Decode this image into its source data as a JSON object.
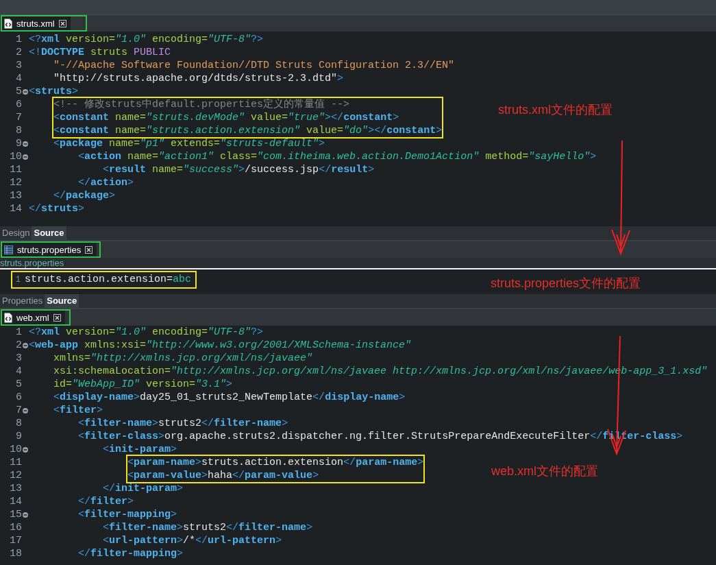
{
  "editors": [
    {
      "kind": "xml",
      "tabs": [
        {
          "label": "struts.xml",
          "selected": true
        }
      ],
      "lines": [
        {
          "num": "1",
          "boxed": false,
          "tokens": [
            {
              "kind": "punct",
              "text": "<?"
            },
            {
              "kind": "tag",
              "text": "xml"
            },
            {
              "kind": "attr",
              "text": " version="
            },
            {
              "kind": "value",
              "text": "\"1.0\""
            },
            {
              "kind": "attr",
              "text": " encoding="
            },
            {
              "kind": "value",
              "text": "\"UTF-8\""
            },
            {
              "kind": "punct",
              "text": "?>"
            }
          ]
        },
        {
          "num": "2",
          "boxed": false,
          "tokens": [
            {
              "kind": "punct",
              "text": "<!"
            },
            {
              "kind": "tag",
              "text": "DOCTYPE"
            },
            {
              "kind": "attr",
              "text": " struts "
            },
            {
              "kind": "keyword",
              "text": "PUBLIC"
            }
          ]
        },
        {
          "num": "3",
          "boxed": false,
          "tokens": [
            {
              "kind": "string",
              "text": "    \"-//Apache Software Foundation//DTD Struts Configuration 2.3//EN\""
            }
          ]
        },
        {
          "num": "4",
          "boxed": false,
          "tokens": [
            {
              "kind": "text",
              "text": "    \"http://struts.apache.org/dtds/struts-2.3.dtd\""
            },
            {
              "kind": "punct",
              "text": ">"
            }
          ]
        },
        {
          "num": "5",
          "foldable": true,
          "boxed": false,
          "tokens": [
            {
              "kind": "punct",
              "text": "<"
            },
            {
              "kind": "tag",
              "text": "struts"
            },
            {
              "kind": "punct",
              "text": ">"
            }
          ]
        },
        {
          "num": "6",
          "boxed": true,
          "tokens": [
            {
              "kind": "comment",
              "text": "    <!-- 修改struts中default.properties定义的常量值 -->"
            }
          ]
        },
        {
          "num": "7",
          "boxed": true,
          "tokens": [
            {
              "kind": "punct",
              "text": "    <"
            },
            {
              "kind": "tag",
              "text": "constant"
            },
            {
              "kind": "attr",
              "text": " name="
            },
            {
              "kind": "value",
              "text": "\"struts.devMode\""
            },
            {
              "kind": "attr",
              "text": " value="
            },
            {
              "kind": "value",
              "text": "\"true\""
            },
            {
              "kind": "punct",
              "text": "></"
            },
            {
              "kind": "tag",
              "text": "constant"
            },
            {
              "kind": "punct",
              "text": ">"
            }
          ]
        },
        {
          "num": "8",
          "boxed": true,
          "tokens": [
            {
              "kind": "punct",
              "text": "    <"
            },
            {
              "kind": "tag",
              "text": "constant"
            },
            {
              "kind": "attr",
              "text": " name="
            },
            {
              "kind": "value",
              "text": "\"struts.action.extension\""
            },
            {
              "kind": "attr",
              "text": " value="
            },
            {
              "kind": "value",
              "text": "\"do\""
            },
            {
              "kind": "punct",
              "text": "></"
            },
            {
              "kind": "tag",
              "text": "constant"
            },
            {
              "kind": "punct",
              "text": ">"
            }
          ]
        },
        {
          "num": "9",
          "foldable": true,
          "boxed": false,
          "tokens": [
            {
              "kind": "punct",
              "text": "    <"
            },
            {
              "kind": "tag",
              "text": "package"
            },
            {
              "kind": "attr",
              "text": " name="
            },
            {
              "kind": "value",
              "text": "\"p1\""
            },
            {
              "kind": "attr",
              "text": " extends="
            },
            {
              "kind": "value",
              "text": "\"struts-default\""
            },
            {
              "kind": "punct",
              "text": ">"
            }
          ]
        },
        {
          "num": "10",
          "foldable": true,
          "boxed": false,
          "tokens": [
            {
              "kind": "punct",
              "text": "        <"
            },
            {
              "kind": "tag",
              "text": "action"
            },
            {
              "kind": "attr",
              "text": " name="
            },
            {
              "kind": "value",
              "text": "\"action1\""
            },
            {
              "kind": "attr",
              "text": " class="
            },
            {
              "kind": "value",
              "text": "\"com.itheima.web.action.Demo1Action\""
            },
            {
              "kind": "attr",
              "text": " method="
            },
            {
              "kind": "value",
              "text": "\"sayHello\""
            },
            {
              "kind": "punct",
              "text": ">"
            }
          ]
        },
        {
          "num": "11",
          "boxed": false,
          "tokens": [
            {
              "kind": "punct",
              "text": "            <"
            },
            {
              "kind": "tag",
              "text": "result"
            },
            {
              "kind": "attr",
              "text": " name="
            },
            {
              "kind": "value",
              "text": "\"success\""
            },
            {
              "kind": "punct",
              "text": ">"
            },
            {
              "kind": "text",
              "text": "/success.jsp"
            },
            {
              "kind": "punct",
              "text": "</"
            },
            {
              "kind": "tag",
              "text": "result"
            },
            {
              "kind": "punct",
              "text": ">"
            }
          ]
        },
        {
          "num": "12",
          "boxed": false,
          "tokens": [
            {
              "kind": "punct",
              "text": "        </"
            },
            {
              "kind": "tag",
              "text": "action"
            },
            {
              "kind": "punct",
              "text": ">"
            }
          ]
        },
        {
          "num": "13",
          "boxed": false,
          "tokens": [
            {
              "kind": "punct",
              "text": "    </"
            },
            {
              "kind": "tag",
              "text": "package"
            },
            {
              "kind": "punct",
              "text": ">"
            }
          ]
        },
        {
          "num": "14",
          "boxed": false,
          "tokens": [
            {
              "kind": "punct",
              "text": "</"
            },
            {
              "kind": "tag",
              "text": "struts"
            },
            {
              "kind": "punct",
              "text": ">"
            }
          ]
        }
      ],
      "view_tabs": [
        {
          "label": "Design",
          "selected": false
        },
        {
          "label": "Source",
          "selected": true
        }
      ]
    },
    {
      "kind": "properties",
      "tabs": [
        {
          "label": "struts.properties",
          "selected": true
        }
      ],
      "breadcrumb": "struts.properties",
      "lines": [
        {
          "num": "1",
          "boxed": true,
          "tokens": [
            {
              "kind": "text",
              "text": "struts.action.extension="
            },
            {
              "kind": "value_plain",
              "text": "abc"
            }
          ]
        }
      ],
      "view_tabs": [
        {
          "label": "Properties",
          "selected": false
        },
        {
          "label": "Source",
          "selected": true
        }
      ]
    },
    {
      "kind": "xml",
      "tabs": [
        {
          "label": "web.xml",
          "selected": true
        }
      ],
      "lines": [
        {
          "num": "1",
          "boxed": false,
          "tokens": [
            {
              "kind": "punct",
              "text": "<?"
            },
            {
              "kind": "tag",
              "text": "xml"
            },
            {
              "kind": "attr",
              "text": " version="
            },
            {
              "kind": "value",
              "text": "\"1.0\""
            },
            {
              "kind": "attr",
              "text": " encoding="
            },
            {
              "kind": "value",
              "text": "\"UTF-8\""
            },
            {
              "kind": "punct",
              "text": "?>"
            }
          ]
        },
        {
          "num": "2",
          "foldable": true,
          "boxed": false,
          "tokens": [
            {
              "kind": "punct",
              "text": "<"
            },
            {
              "kind": "tag",
              "text": "web-app"
            },
            {
              "kind": "attr",
              "text": " xmlns:xsi="
            },
            {
              "kind": "value",
              "text": "\"http://www.w3.org/2001/XMLSchema-instance\""
            }
          ]
        },
        {
          "num": "3",
          "boxed": false,
          "tokens": [
            {
              "kind": "attr",
              "text": "    xmlns="
            },
            {
              "kind": "value",
              "text": "\"http://xmlns.jcp.org/xml/ns/javaee\""
            }
          ]
        },
        {
          "num": "4",
          "boxed": false,
          "tokens": [
            {
              "kind": "attr",
              "text": "    xsi:schemaLocation="
            },
            {
              "kind": "value",
              "text": "\"http://xmlns.jcp.org/xml/ns/javaee http://xmlns.jcp.org/xml/ns/javaee/web-app_3_1.xsd\""
            }
          ]
        },
        {
          "num": "5",
          "boxed": false,
          "tokens": [
            {
              "kind": "attr",
              "text": "    id="
            },
            {
              "kind": "value",
              "text": "\"WebApp_ID\""
            },
            {
              "kind": "attr",
              "text": " version="
            },
            {
              "kind": "value",
              "text": "\"3.1\""
            },
            {
              "kind": "punct",
              "text": ">"
            }
          ]
        },
        {
          "num": "6",
          "boxed": false,
          "tokens": [
            {
              "kind": "punct",
              "text": "    <"
            },
            {
              "kind": "tag",
              "text": "display-name"
            },
            {
              "kind": "punct",
              "text": ">"
            },
            {
              "kind": "text",
              "text": "day25_01_struts2_NewTemplate"
            },
            {
              "kind": "punct",
              "text": "</"
            },
            {
              "kind": "tag",
              "text": "display-name"
            },
            {
              "kind": "punct",
              "text": ">"
            }
          ]
        },
        {
          "num": "7",
          "foldable": true,
          "boxed": false,
          "tokens": [
            {
              "kind": "punct",
              "text": "    <"
            },
            {
              "kind": "tag",
              "text": "filter"
            },
            {
              "kind": "punct",
              "text": ">"
            }
          ]
        },
        {
          "num": "8",
          "boxed": false,
          "tokens": [
            {
              "kind": "punct",
              "text": "        <"
            },
            {
              "kind": "tag",
              "text": "filter-name"
            },
            {
              "kind": "punct",
              "text": ">"
            },
            {
              "kind": "text",
              "text": "struts2"
            },
            {
              "kind": "punct",
              "text": "</"
            },
            {
              "kind": "tag",
              "text": "filter-name"
            },
            {
              "kind": "punct",
              "text": ">"
            }
          ]
        },
        {
          "num": "9",
          "boxed": false,
          "tokens": [
            {
              "kind": "punct",
              "text": "        <"
            },
            {
              "kind": "tag",
              "text": "filter-class"
            },
            {
              "kind": "punct",
              "text": ">"
            },
            {
              "kind": "text",
              "text": "org.apache.struts2.dispatcher.ng.filter.StrutsPrepareAndExecuteFilter"
            },
            {
              "kind": "punct",
              "text": "</"
            },
            {
              "kind": "tag",
              "text": "filter-class"
            },
            {
              "kind": "punct",
              "text": ">"
            }
          ]
        },
        {
          "num": "10",
          "foldable": true,
          "boxed": false,
          "tokens": [
            {
              "kind": "punct",
              "text": "            <"
            },
            {
              "kind": "tag",
              "text": "init-param"
            },
            {
              "kind": "punct",
              "text": ">"
            }
          ]
        },
        {
          "num": "11",
          "boxed": true,
          "tokens": [
            {
              "kind": "punct",
              "text": "                <"
            },
            {
              "kind": "tag",
              "text": "param-name"
            },
            {
              "kind": "punct",
              "text": ">"
            },
            {
              "kind": "text",
              "text": "struts.action.extension"
            },
            {
              "kind": "punct",
              "text": "</"
            },
            {
              "kind": "tag",
              "text": "param-name"
            },
            {
              "kind": "punct",
              "text": ">"
            }
          ]
        },
        {
          "num": "12",
          "boxed": true,
          "tokens": [
            {
              "kind": "punct",
              "text": "                <"
            },
            {
              "kind": "tag",
              "text": "param-value"
            },
            {
              "kind": "punct",
              "text": ">"
            },
            {
              "kind": "text",
              "text": "haha"
            },
            {
              "kind": "punct",
              "text": "</"
            },
            {
              "kind": "tag",
              "text": "param-value"
            },
            {
              "kind": "punct",
              "text": ">"
            }
          ]
        },
        {
          "num": "13",
          "boxed": false,
          "tokens": [
            {
              "kind": "punct",
              "text": "            </"
            },
            {
              "kind": "tag",
              "text": "init-param"
            },
            {
              "kind": "punct",
              "text": ">"
            }
          ]
        },
        {
          "num": "14",
          "boxed": false,
          "tokens": [
            {
              "kind": "punct",
              "text": "        </"
            },
            {
              "kind": "tag",
              "text": "filter"
            },
            {
              "kind": "punct",
              "text": ">"
            }
          ]
        },
        {
          "num": "15",
          "foldable": true,
          "boxed": false,
          "tokens": [
            {
              "kind": "punct",
              "text": "        <"
            },
            {
              "kind": "tag",
              "text": "filter-mapping"
            },
            {
              "kind": "punct",
              "text": ">"
            }
          ]
        },
        {
          "num": "16",
          "boxed": false,
          "tokens": [
            {
              "kind": "punct",
              "text": "            <"
            },
            {
              "kind": "tag",
              "text": "filter-name"
            },
            {
              "kind": "punct",
              "text": ">"
            },
            {
              "kind": "text",
              "text": "struts2"
            },
            {
              "kind": "punct",
              "text": "</"
            },
            {
              "kind": "tag",
              "text": "filter-name"
            },
            {
              "kind": "punct",
              "text": ">"
            }
          ]
        },
        {
          "num": "17",
          "boxed": false,
          "tokens": [
            {
              "kind": "punct",
              "text": "            <"
            },
            {
              "kind": "tag",
              "text": "url-pattern"
            },
            {
              "kind": "punct",
              "text": ">"
            },
            {
              "kind": "text",
              "text": "/*"
            },
            {
              "kind": "punct",
              "text": "</"
            },
            {
              "kind": "tag",
              "text": "url-pattern"
            },
            {
              "kind": "punct",
              "text": ">"
            }
          ]
        },
        {
          "num": "18",
          "boxed": false,
          "tokens": [
            {
              "kind": "punct",
              "text": "        </"
            },
            {
              "kind": "tag",
              "text": "filter-mapping"
            },
            {
              "kind": "punct",
              "text": ">"
            }
          ]
        }
      ]
    }
  ],
  "annotations": [
    {
      "text": "struts.xml文件的配置"
    },
    {
      "text": "struts.properties文件的配置"
    },
    {
      "text": "web.xml文件的配置"
    }
  ]
}
